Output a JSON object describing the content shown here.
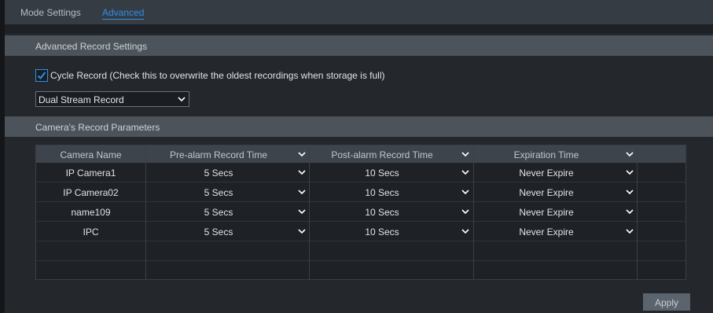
{
  "tabs": [
    {
      "label": "Mode Settings"
    },
    {
      "label": "Advanced"
    }
  ],
  "sections": {
    "advanced_title": "Advanced Record Settings",
    "camera_params_title": "Camera's Record Parameters"
  },
  "cycle_record": {
    "checked": true,
    "label": "Cycle Record (Check this to overwrite the oldest recordings when storage is full)"
  },
  "stream_select": {
    "value": "Dual Stream Record"
  },
  "table": {
    "headers": [
      "Camera Name",
      "Pre-alarm Record Time",
      "Post-alarm Record Time",
      "Expiration Time"
    ],
    "rows": [
      {
        "name": "IP Camera1",
        "pre": "5 Secs",
        "post": "10 Secs",
        "expire": "Never Expire"
      },
      {
        "name": "IP Camera02",
        "pre": "5 Secs",
        "post": "10 Secs",
        "expire": "Never Expire"
      },
      {
        "name": "name109",
        "pre": "5 Secs",
        "post": "10 Secs",
        "expire": "Never Expire"
      },
      {
        "name": "IPC",
        "pre": "5 Secs",
        "post": "10 Secs",
        "expire": "Never Expire"
      }
    ]
  },
  "apply_label": "Apply",
  "colors": {
    "accent": "#2f8fea",
    "section_bar": "#4c535b",
    "background": "#24282d"
  },
  "icons": {
    "checkbox": "checkmark-icon",
    "dropdown": "chevron-down-icon"
  }
}
